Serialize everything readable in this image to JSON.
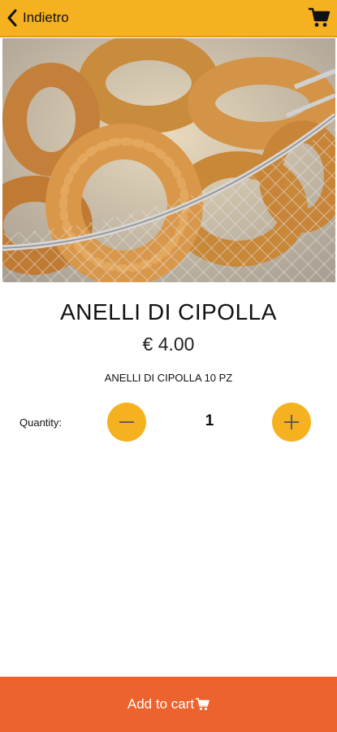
{
  "header": {
    "back_label": "Indietro",
    "back_icon": "chevron-left-icon",
    "cart_icon": "cart-icon",
    "bar_color": "#f6b120"
  },
  "product": {
    "name": "ANELLI DI CIPOLLA",
    "price": "€ 4.00",
    "description": "ANELLI DI CIPOLLA 10 PZ",
    "image": "onion-rings-photo"
  },
  "quantity": {
    "label": "Quantity:",
    "value": "1",
    "decrement_icon": "minus-icon",
    "increment_icon": "plus-icon"
  },
  "footer": {
    "add_to_cart_label": "Add to cart",
    "cart_icon": "cart-icon",
    "bar_color": "#ec632e"
  }
}
